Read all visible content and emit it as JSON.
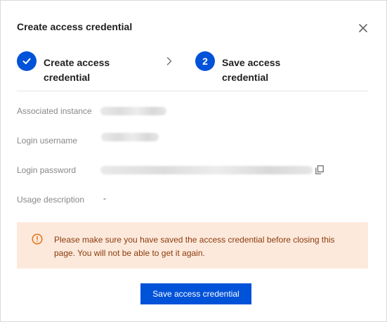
{
  "dialog": {
    "title": "Create access credential",
    "close_icon": "close-icon"
  },
  "steps": [
    {
      "icon": "check-icon",
      "label": "Create access credential",
      "state": "done"
    },
    {
      "number": "2",
      "label": "Save access credential",
      "state": "active"
    }
  ],
  "step_separator_icon": "chevron-right-icon",
  "fields": {
    "associated_instance": {
      "label": "Associated instance",
      "value_state": "obscured"
    },
    "login_username": {
      "label": "Login username",
      "value_state": "obscured"
    },
    "login_password": {
      "label": "Login password",
      "value_state": "obscured",
      "copy_icon": "copy-icon"
    },
    "usage_description": {
      "label": "Usage description",
      "value": "-"
    }
  },
  "warning": {
    "icon": "warning-circle-icon",
    "text": "Please make sure you have saved the access credential before closing this page. You will not be able to get it again."
  },
  "save_button": {
    "label": "Save access credential"
  },
  "colors": {
    "primary": "#0052d9",
    "warning_bg": "#fde9dc",
    "warning_text": "#8a3b0c",
    "warning_icon": "#e37318"
  }
}
